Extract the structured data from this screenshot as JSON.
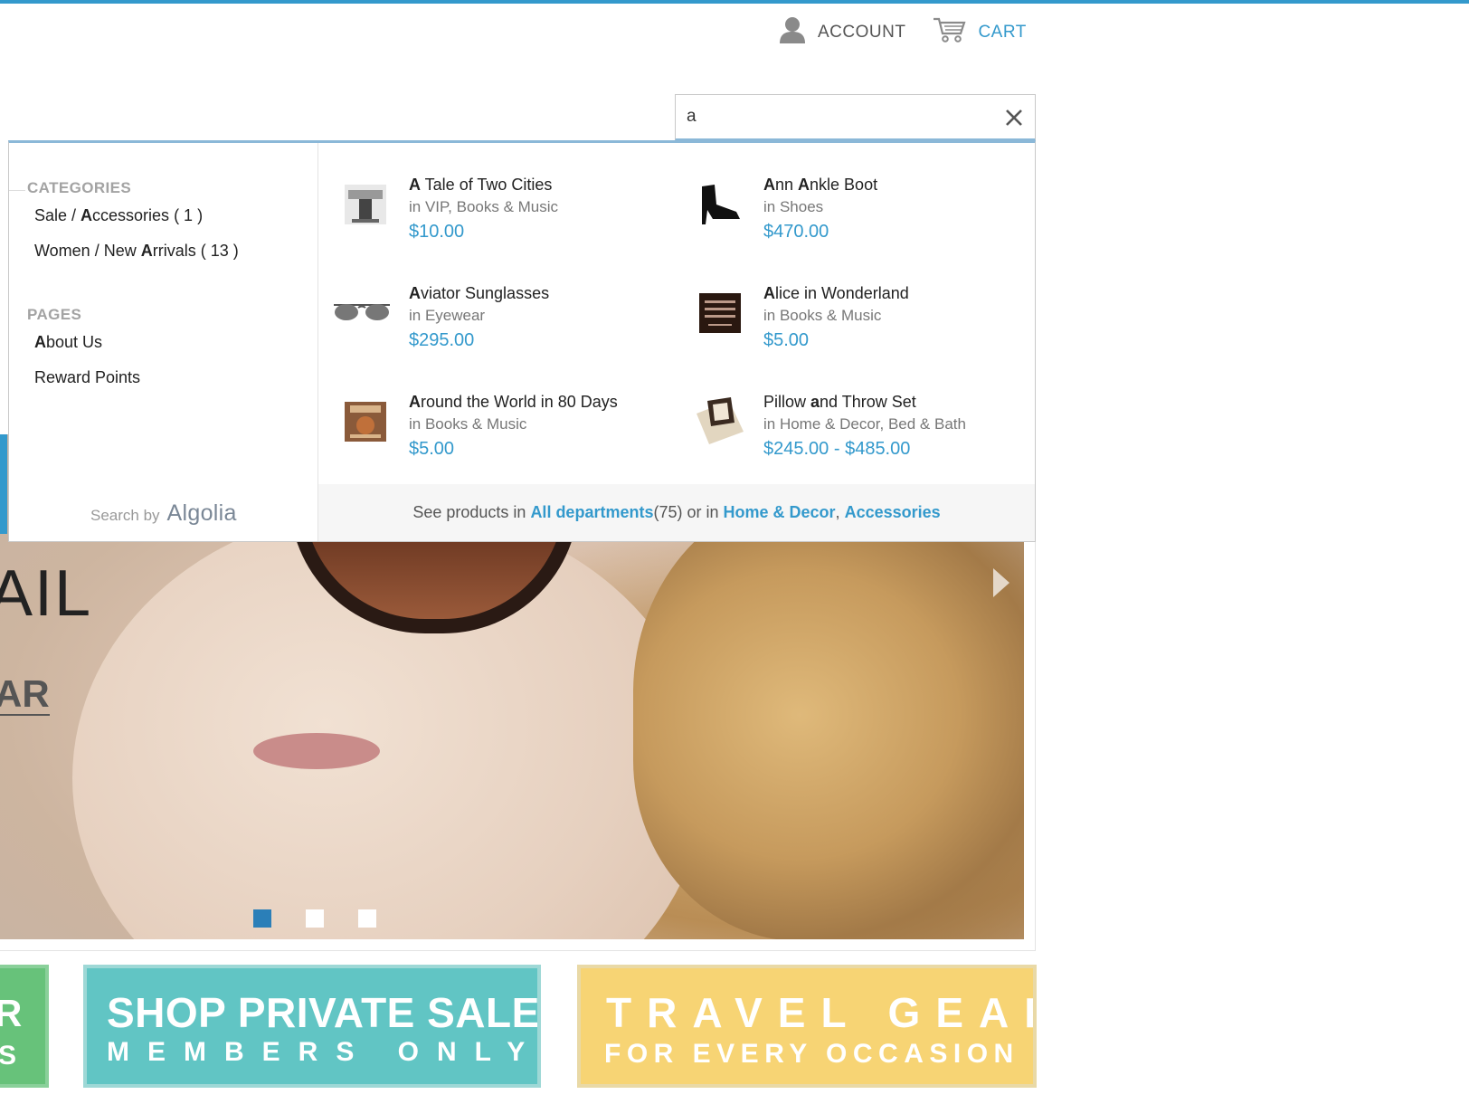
{
  "header": {
    "account_label": "ACCOUNT",
    "cart_label": "CART",
    "accent_color": "#3399cc"
  },
  "search": {
    "value": "a",
    "placeholder": ""
  },
  "dropdown": {
    "categories_title": "CATEGORIES",
    "categories": [
      {
        "prefix": "Sale / ",
        "bold": "A",
        "rest": "ccessories",
        "count": " ( 1 )"
      },
      {
        "prefix": "Women / New ",
        "bold": "A",
        "rest": "rrivals",
        "count": " ( 13 )"
      }
    ],
    "pages_title": "PAGES",
    "pages": [
      {
        "bold": "A",
        "rest": "bout Us"
      },
      {
        "bold": "",
        "rest": "Reward Points"
      }
    ],
    "search_by_label": "Search by",
    "search_by_brand": "Algolia",
    "hits": [
      {
        "name_bold": "A",
        "name_rest": " Tale of Two Cities",
        "category": "in VIP, Books & Music",
        "price": "$10.00",
        "icon": "book-cover-icon"
      },
      {
        "name_bold": "A",
        "name_mid": "nn ",
        "name_bold2": "A",
        "name_rest": "nkle Boot",
        "category": "in Shoes",
        "price": "$470.00",
        "icon": "ankle-boot-icon"
      },
      {
        "name_bold": "A",
        "name_rest": "viator Sunglasses",
        "category": "in Eyewear",
        "price": "$295.00",
        "icon": "sunglasses-icon"
      },
      {
        "name_bold": "A",
        "name_rest": "lice in Wonderland",
        "category": "in Books & Music",
        "price": "$5.00",
        "icon": "book-cover-icon"
      },
      {
        "name_bold": "A",
        "name_rest": "round the World in 80 Days",
        "category": "in Books & Music",
        "price": "$5.00",
        "icon": "book-cover-icon"
      },
      {
        "name_pre": "Pillow ",
        "name_bold": "a",
        "name_rest": "nd Throw Set",
        "category": "in Home & Decor, Bed & Bath",
        "price": "$245.00 - $485.00",
        "icon": "pillow-icon"
      }
    ],
    "footer": {
      "prefix": "See products in ",
      "all_link": "All departments",
      "count": " (75) or in ",
      "dept1": "Home & Decor",
      "sep": ", ",
      "dept2": "Accessories"
    }
  },
  "hero": {
    "text_partial_1": "AIL",
    "text_partial_2": "AR",
    "active_slide": 1,
    "slide_count": 3
  },
  "promos": {
    "green_line1": "R",
    "green_line2": "S",
    "teal_line1": "SHOP PRIVATE SALES",
    "teal_line2": "MEMBERS ONLY",
    "yellow_line1": "TRAVEL GEAR",
    "yellow_line2": "FOR EVERY OCCASION"
  }
}
